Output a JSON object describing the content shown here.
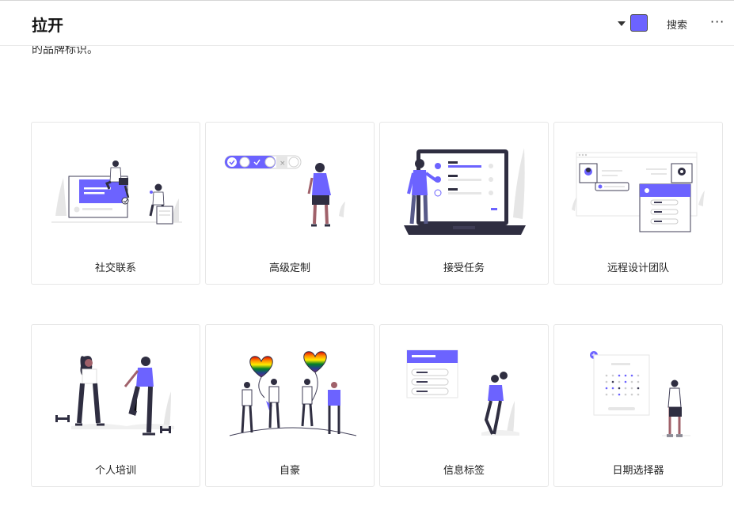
{
  "header": {
    "title": "拉开",
    "search_label": "搜索",
    "more_label": "···",
    "accent_color": "#6c63ff",
    "dropdown_icon": "caret-down-icon",
    "color_swatch_icon": "color-swatch-icon"
  },
  "intro_text": "的品牌标识。",
  "cards": [
    {
      "label": "社交联系",
      "illustration": "social-connection-illustration"
    },
    {
      "label": "高级定制",
      "illustration": "advanced-customization-illustration"
    },
    {
      "label": "接受任务",
      "illustration": "accept-tasks-illustration"
    },
    {
      "label": "远程设计团队",
      "illustration": "remote-design-team-illustration"
    },
    {
      "label": "个人培训",
      "illustration": "personal-training-illustration"
    },
    {
      "label": "自豪",
      "illustration": "pride-illustration"
    },
    {
      "label": "信息标签",
      "illustration": "info-tags-illustration"
    },
    {
      "label": "日期选择器",
      "illustration": "date-picker-illustration"
    }
  ]
}
